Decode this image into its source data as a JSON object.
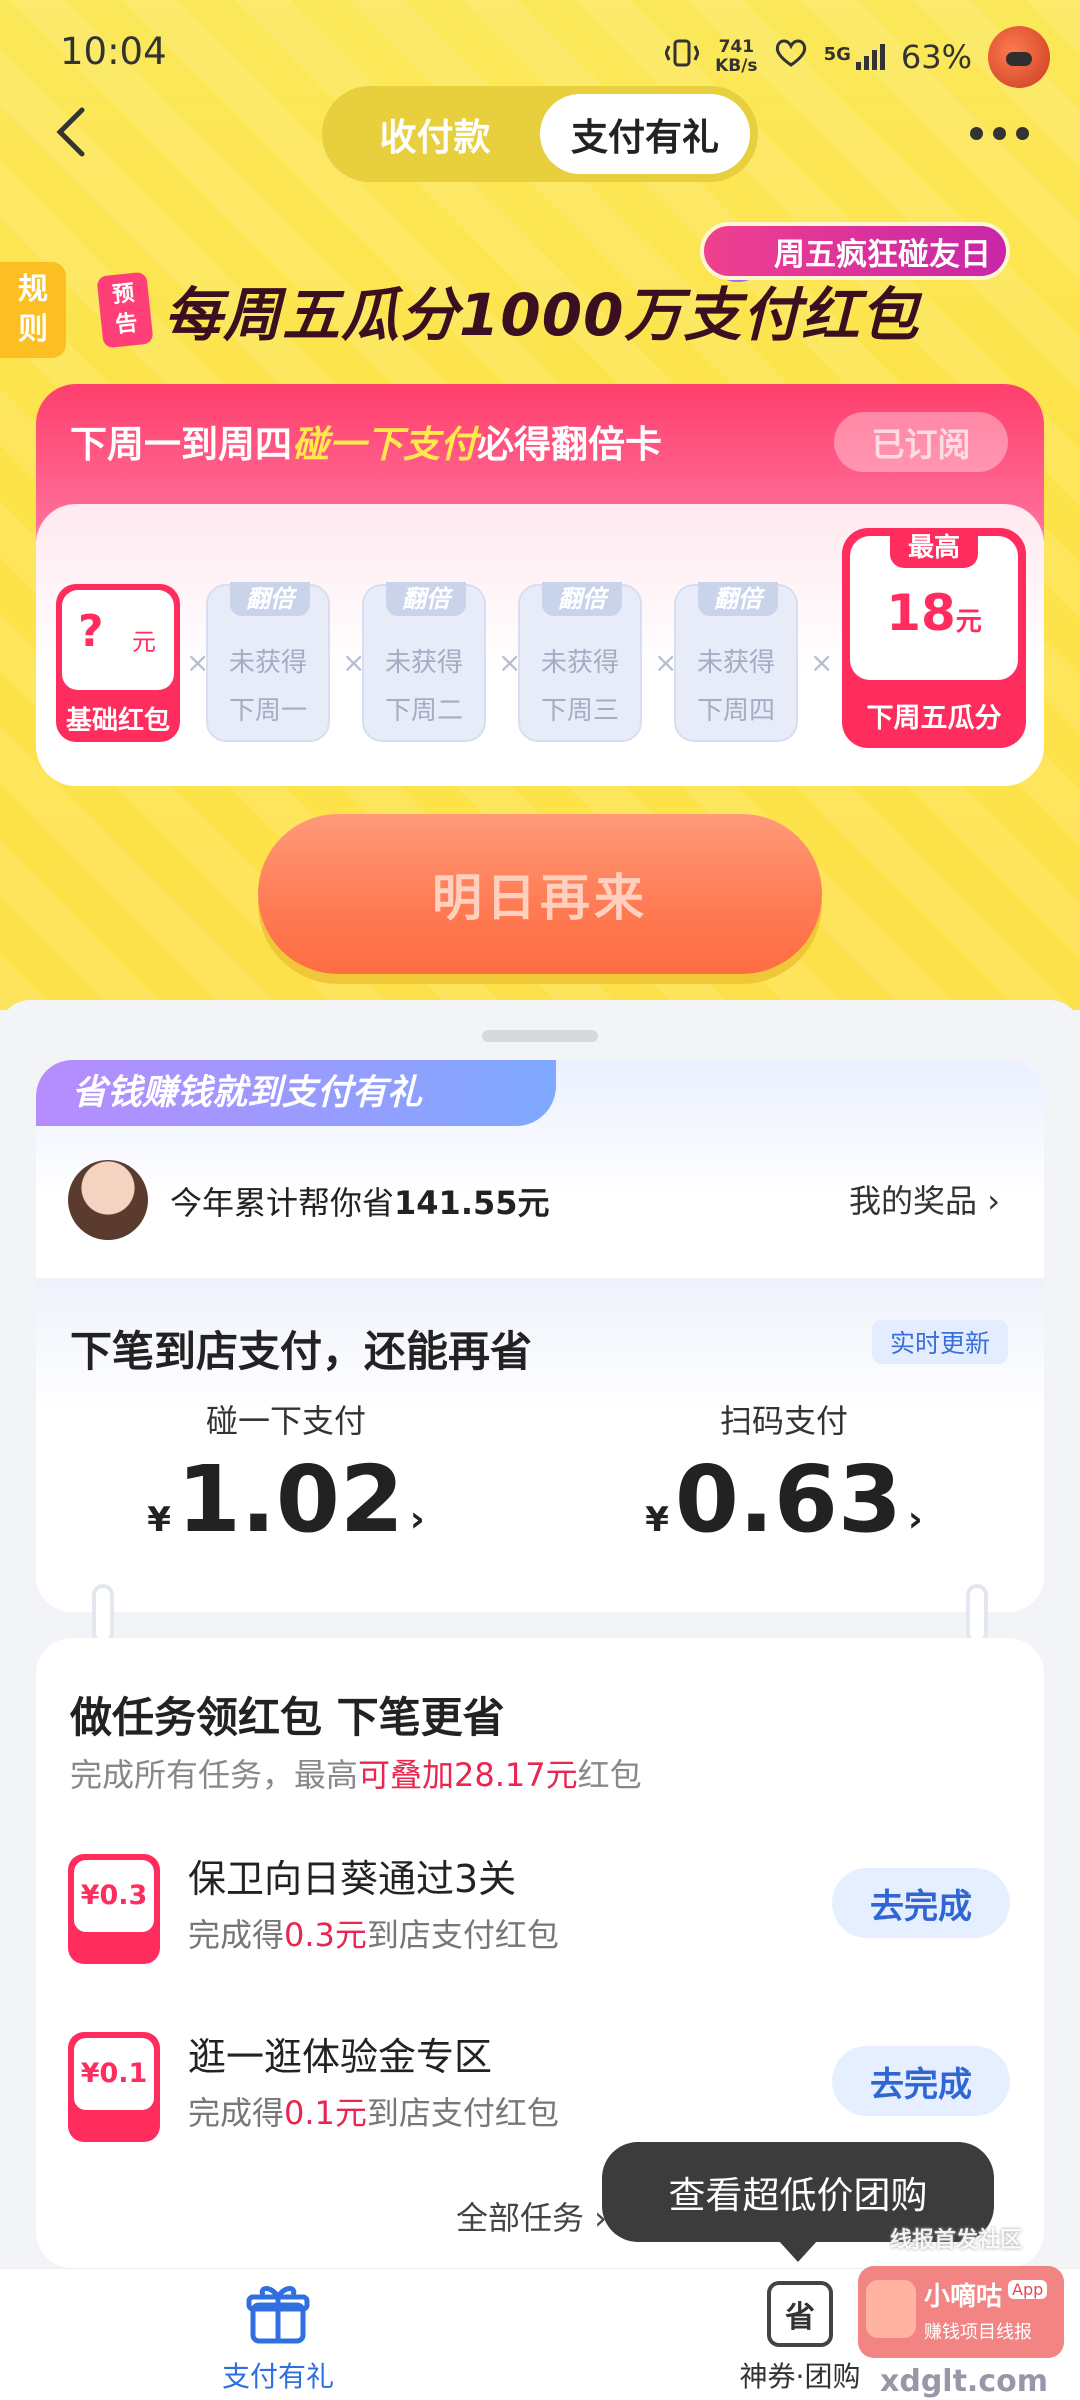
{
  "status_bar": {
    "time": "10:04",
    "speed_value": "741",
    "speed_unit": "KB/s",
    "network": "5G",
    "battery": "63%"
  },
  "nav": {
    "tabs": [
      {
        "label": "收付款",
        "active": false
      },
      {
        "label": "支付有礼",
        "active": true
      }
    ]
  },
  "banner": {
    "rules": "规则",
    "friday_tag": "周五疯狂碰友日",
    "preview_badge": "预告",
    "title": "每周五瓜分1000万支付红包"
  },
  "double_card": {
    "head_prefix": "下周一到周四",
    "head_highlight": "碰一下支付",
    "head_suffix": "必得翻倍卡",
    "subscribed": "已订阅",
    "base": {
      "amount": "?",
      "unit": "元",
      "label": "基础红包"
    },
    "slots": [
      {
        "tag": "翻倍",
        "status": "未获得",
        "day": "下周一"
      },
      {
        "tag": "翻倍",
        "status": "未获得",
        "day": "下周二"
      },
      {
        "tag": "翻倍",
        "status": "未获得",
        "day": "下周三"
      },
      {
        "tag": "翻倍",
        "status": "未获得",
        "day": "下周四"
      }
    ],
    "times_symbol": "×",
    "max": {
      "tag": "最高",
      "amount": "18",
      "unit": "元",
      "label": "下周五瓜分"
    }
  },
  "cta": {
    "label": "明日再来"
  },
  "savings": {
    "ribbon": "省钱赚钱就到支付有礼",
    "saved_prefix": "今年累计帮你省",
    "saved_amount": "141.55元",
    "prizes_link": "我的奖品 ›",
    "next_title": "下笔到店支付，还能再省",
    "realtime": "实时更新",
    "currency": "¥",
    "arrow": "›",
    "pay_methods": [
      {
        "label": "碰一下支付",
        "value": "1.02"
      },
      {
        "label": "扫码支付",
        "value": "0.63"
      }
    ]
  },
  "tasks": {
    "title": "做任务领红包 下笔更省",
    "sub_prefix": "完成所有任务，最高",
    "sub_highlight": "可叠加28.17元",
    "sub_suffix": "红包",
    "items": [
      {
        "icon_value": "¥0.3",
        "name": "保卫向日葵通过3关",
        "desc_prefix": "完成得",
        "desc_amount": "0.3元",
        "desc_suffix": "到店支付红包",
        "button": "去完成"
      },
      {
        "icon_value": "¥0.1",
        "name": "逛一逛体验金专区",
        "desc_prefix": "完成得",
        "desc_amount": "0.1元",
        "desc_suffix": "到店支付红包",
        "button": "去完成"
      }
    ],
    "all_tasks": "全部任务 ›"
  },
  "tooltip": {
    "text": "查看超低价团购"
  },
  "bottom_nav": {
    "items": [
      {
        "label": "支付有礼",
        "active": true,
        "color": "#2f6fe0"
      },
      {
        "label": "神券·团购",
        "active": false,
        "color": "#333333"
      }
    ]
  },
  "watermark": {
    "line1": "线报首发社区",
    "name": "小嘀咕",
    "app": "App",
    "slogan": "赚钱项目线报",
    "url": "xdglt.com"
  },
  "colors": {
    "accent_red": "#ff2d5e",
    "brand_yellow": "#fde34a",
    "blue": "#2f6fe0"
  }
}
